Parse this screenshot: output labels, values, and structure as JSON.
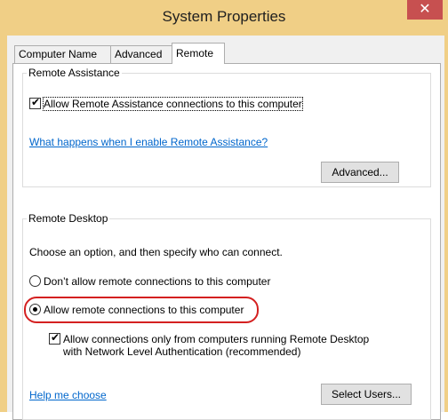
{
  "window": {
    "title": "System Properties",
    "close_glyph": "✕"
  },
  "tabs": [
    {
      "label": "Computer Name"
    },
    {
      "label": "Advanced"
    },
    {
      "label": "Remote"
    }
  ],
  "remote_assistance": {
    "legend": "Remote Assistance",
    "allow_checkbox": {
      "label": "Allow Remote Assistance connections to this computer",
      "checked": true
    },
    "help_link": "What happens when I enable Remote Assistance?",
    "advanced_button": "Advanced..."
  },
  "remote_desktop": {
    "legend": "Remote Desktop",
    "instructions": "Choose an option, and then specify who can connect.",
    "option_dont_allow": {
      "label": "Don’t allow remote connections to this computer",
      "selected": false
    },
    "option_allow": {
      "label": "Allow remote connections to this computer",
      "selected": true
    },
    "nla_checkbox": {
      "line1": "Allow connections only from computers running Remote Desktop",
      "line2": "with Network Level Authentication (recommended)",
      "checked": true
    },
    "help_link": "Help me choose",
    "select_users_button": "Select Users..."
  },
  "colors": {
    "titlebar": "#f0cf86",
    "close": "#c75050",
    "link": "#0066cc",
    "highlight": "#d42020"
  }
}
